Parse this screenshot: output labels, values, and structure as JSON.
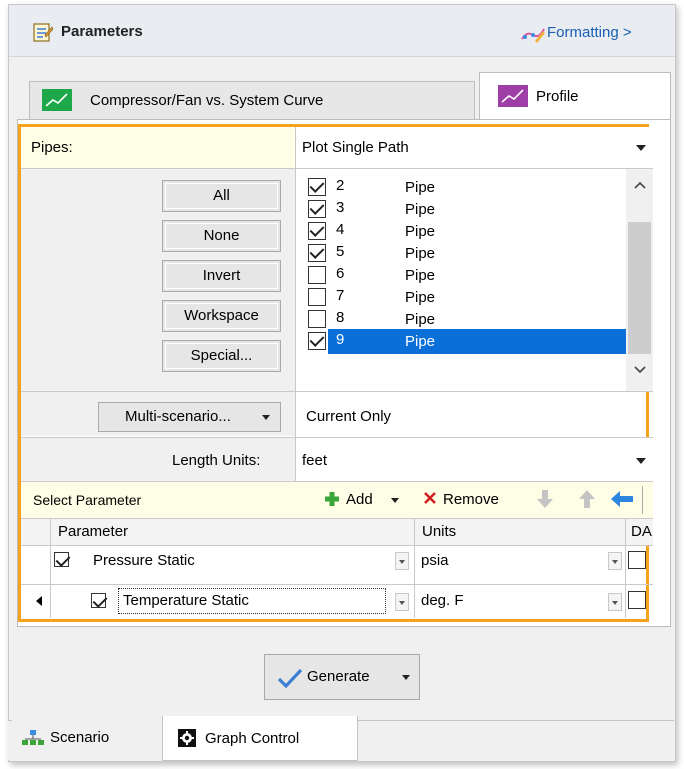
{
  "header": {
    "title": "Parameters",
    "formatting_label": "Formatting >"
  },
  "tabs": [
    {
      "label": "Compressor/Fan vs. System Curve",
      "icon": "green-chart-icon",
      "active": false
    },
    {
      "label": "Profile",
      "icon": "purple-chart-icon",
      "active": true
    }
  ],
  "pipes": {
    "label": "Pipes:",
    "mode": "Plot Single Path",
    "buttons": [
      "All",
      "None",
      "Invert",
      "Workspace",
      "Special..."
    ],
    "list": [
      {
        "id": "2",
        "type": "Pipe",
        "checked": true,
        "selected": false
      },
      {
        "id": "3",
        "type": "Pipe",
        "checked": true,
        "selected": false
      },
      {
        "id": "4",
        "type": "Pipe",
        "checked": true,
        "selected": false
      },
      {
        "id": "5",
        "type": "Pipe",
        "checked": true,
        "selected": false
      },
      {
        "id": "6",
        "type": "Pipe",
        "checked": false,
        "selected": false
      },
      {
        "id": "7",
        "type": "Pipe",
        "checked": false,
        "selected": false
      },
      {
        "id": "8",
        "type": "Pipe",
        "checked": false,
        "selected": false
      },
      {
        "id": "9",
        "type": "Pipe",
        "checked": true,
        "selected": true
      }
    ]
  },
  "scenario": {
    "button_label": "Multi-scenario...",
    "value": "Current Only"
  },
  "length_units": {
    "label": "Length Units:",
    "value": "feet"
  },
  "select_parameter": {
    "label": "Select Parameter",
    "add_label": "Add",
    "remove_label": "Remove"
  },
  "param_table": {
    "headers": [
      "Parameter",
      "Units",
      "DA"
    ],
    "rows": [
      {
        "checked": true,
        "parameter": "Pressure Static",
        "units": "psia",
        "da": false
      },
      {
        "checked": true,
        "parameter": "Temperature Static",
        "units": "deg. F",
        "da": false
      }
    ]
  },
  "generate_label": "Generate",
  "bottom_tabs": [
    {
      "label": "Scenario",
      "icon": "scenario-tree-icon",
      "active": false
    },
    {
      "label": "Graph Control",
      "icon": "gear-icon",
      "active": true
    }
  ],
  "colors": {
    "accent_orange": "#f6a21c",
    "selection_blue": "#0a6fd8",
    "link_blue": "#1a5fb4",
    "pipes_label_bg": "#fefee6"
  }
}
